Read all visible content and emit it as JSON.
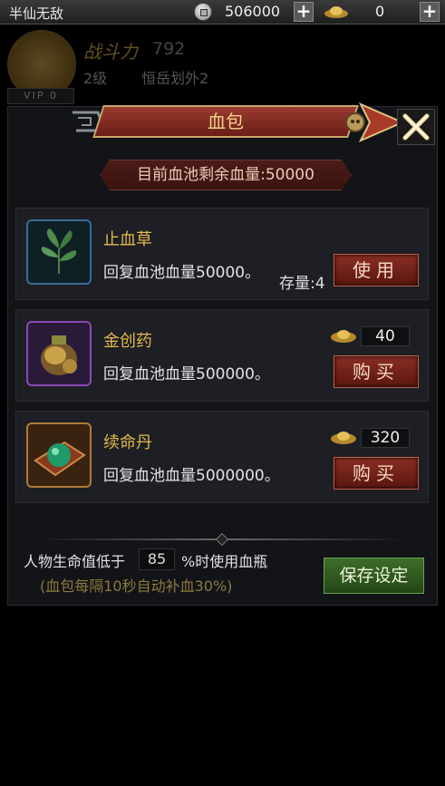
{
  "topbar": {
    "player_name": "半仙无敌",
    "copper": "506000",
    "gold": "0"
  },
  "profile": {
    "power_label": "战斗力",
    "power_value": "792",
    "level": "2级",
    "location": "恒岳划外2",
    "vip": "VIP 0"
  },
  "panel": {
    "title": "血包",
    "pool_text": "目前血池剩余血量:50000",
    "items": [
      {
        "name": "止血草",
        "desc": "回复血池血量50000。",
        "stock": "存量:4",
        "button": "使用",
        "icon": "herb-icon"
      },
      {
        "name": "金创药",
        "desc": "回复血池血量500000。",
        "price": "40",
        "button": "购买",
        "icon": "medicine-pouch-icon"
      },
      {
        "name": "续命丹",
        "desc": "回复血池血量5000000。",
        "price": "320",
        "button": "购买",
        "icon": "green-pill-icon"
      }
    ],
    "hp_label": "人物生命值低于",
    "hp_threshold": "85",
    "hp_suffix": "%时使用血瓶",
    "hint": "(血包每隔10秒自动补血30%)",
    "save_button": "保存设定"
  },
  "colors": {
    "accent_gold": "#e2b84a",
    "button_red": "#8a2e24",
    "button_green": "#3f6d2a"
  }
}
